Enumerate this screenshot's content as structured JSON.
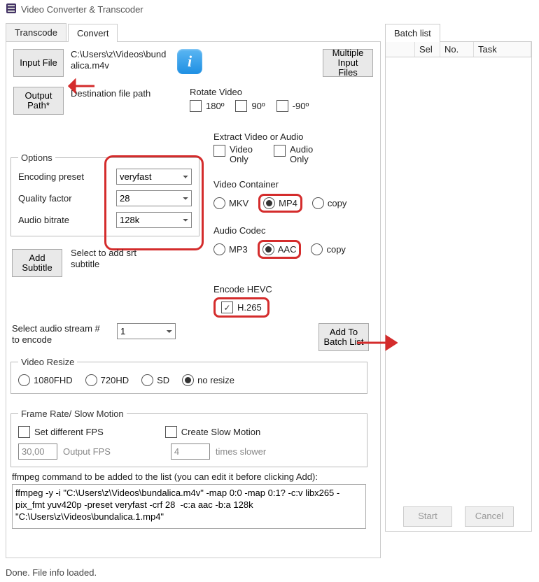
{
  "window": {
    "title": "Video Converter & Transcoder"
  },
  "tabs": {
    "transcode": "Transcode",
    "convert": "Convert",
    "active": "convert"
  },
  "batchTab": {
    "title": "Batch list",
    "cols": [
      "Sel",
      "No.",
      "Task"
    ]
  },
  "buttons": {
    "inputFile": "Input File",
    "outputPath": "Output\nPath*",
    "multiInput": "Multiple\nInput Files",
    "addSubtitle": "Add\nSubtitle",
    "addBatch": "Add To\nBatch List",
    "start": "Start",
    "cancel": "Cancel"
  },
  "paths": {
    "input": "C:\\Users\\z\\Videos\\bundalica.m4v",
    "destLabel": "Destination file path"
  },
  "options": {
    "legend": "Options",
    "encodingPreset": {
      "label": "Encoding preset",
      "value": "veryfast"
    },
    "qualityFactor": {
      "label": "Quality factor",
      "value": "28"
    },
    "audioBitrate": {
      "label": "Audio bitrate",
      "value": "128k"
    }
  },
  "subtitleHint": "Select to add srt subtitle",
  "rotate": {
    "legend": "Rotate Video",
    "o180": {
      "label": "180º",
      "checked": false
    },
    "o90": {
      "label": "90º",
      "checked": false
    },
    "oM90": {
      "label": "-90º",
      "checked": false
    }
  },
  "extract": {
    "legend": "Extract Video or Audio",
    "video": {
      "label": "Video\nOnly",
      "checked": false
    },
    "audio": {
      "label": "Audio\nOnly",
      "checked": false
    }
  },
  "container": {
    "legend": "Video Container",
    "options": [
      "MKV",
      "MP4",
      "copy"
    ],
    "selected": "MP4"
  },
  "audioCodec": {
    "legend": "Audio Codec",
    "options": [
      "MP3",
      "AAC",
      "copy"
    ],
    "selected": "AAC"
  },
  "hevc": {
    "legend": "Encode HEVC",
    "label": "H.265",
    "checked": true
  },
  "audioStream": {
    "label": "Select audio stream # to encode",
    "value": "1"
  },
  "resize": {
    "legend": "Video Resize",
    "options": [
      "1080FHD",
      "720HD",
      "SD",
      "no resize"
    ],
    "selected": "no resize"
  },
  "frameRate": {
    "legend": "Frame Rate/ Slow Motion",
    "setFps": {
      "label": "Set different FPS",
      "checked": false
    },
    "fpsValue": "30,00",
    "fpsHint": "Output FPS",
    "slow": {
      "label": "Create Slow Motion",
      "checked": false
    },
    "slowValue": "4",
    "slowHint": "times slower"
  },
  "cmd": {
    "label": "ffmpeg command to be added to the list (you can edit it before clicking Add):",
    "text": "ffmpeg -y -i \"C:\\Users\\z\\Videos\\bundalica.m4v\" -map 0:0 -map 0:1? -c:v libx265 -pix_fmt yuv420p -preset veryfast -crf 28  -c:a aac -b:a 128k \"C:\\Users\\z\\Videos\\bundalica.1.mp4\""
  },
  "status": "Done. File info loaded."
}
